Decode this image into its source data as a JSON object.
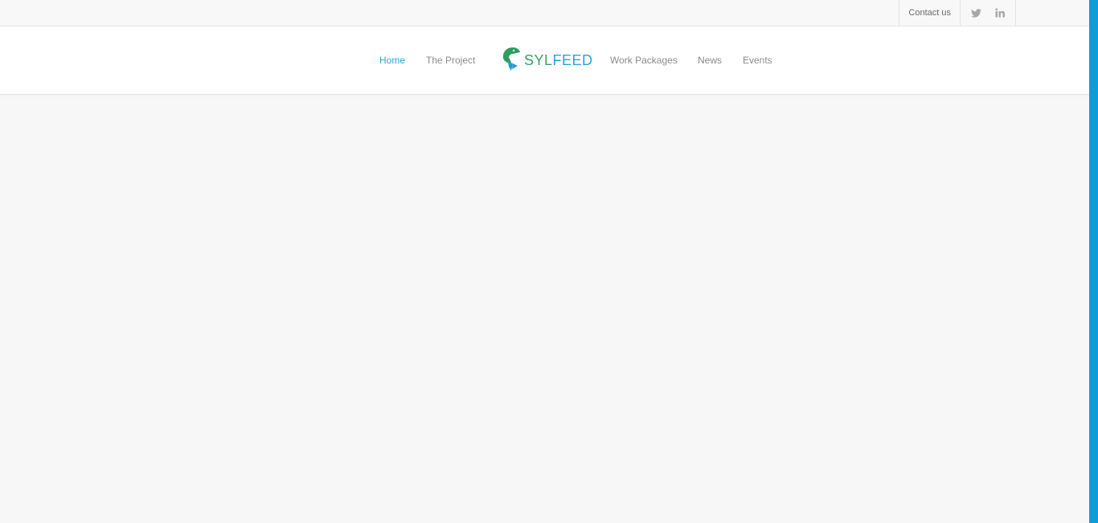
{
  "topbar": {
    "contact_label": "Contact us",
    "social": [
      {
        "icon": "twitter-icon"
      },
      {
        "icon": "linkedin-icon"
      }
    ]
  },
  "nav": {
    "items_left": [
      {
        "label": "Home",
        "active": true
      },
      {
        "label": "The Project",
        "active": false
      }
    ],
    "logo": {
      "part1": "SYL",
      "part2": "FEED"
    },
    "items_right": [
      {
        "label": "Work Packages",
        "active": false
      },
      {
        "label": "News",
        "active": false
      },
      {
        "label": "Events",
        "active": false
      }
    ]
  },
  "colors": {
    "accent": "#2aa3d6",
    "brand_green": "#3ba068",
    "stripe": "#129bd9",
    "background": "#f7f7f7"
  }
}
